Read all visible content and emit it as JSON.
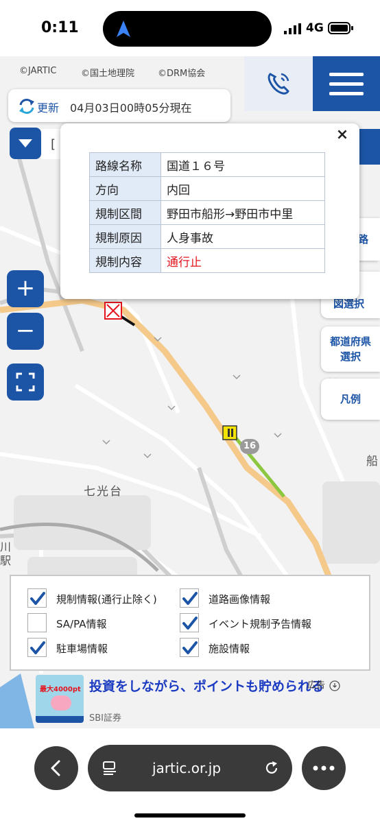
{
  "status_bar": {
    "time": "0:11",
    "network": "4G"
  },
  "map": {
    "credits": [
      "©JARTIC",
      "©国土地理院",
      "©DRM協会"
    ],
    "place_label": "七光台",
    "route_shield": "16",
    "edge_label_right": "船",
    "edge_label_left": "川駅"
  },
  "update": {
    "label": "更新",
    "timestamp": "04月03日00時05分現在"
  },
  "search": {
    "partial_text": "["
  },
  "zoom": {
    "in_label": "+",
    "out_label": "−"
  },
  "side_buttons": [
    {
      "label": "路"
    },
    {
      "label": "路\n図選択"
    },
    {
      "label": "都道府県\n選択"
    },
    {
      "label": "凡例"
    }
  ],
  "popup": {
    "close_label": "×",
    "rows": [
      {
        "key": "路線名称",
        "value": "国道１６号"
      },
      {
        "key": "方向",
        "value": "内回"
      },
      {
        "key": "規制区間",
        "value": "野田市船形→野田市中里"
      },
      {
        "key": "規制原因",
        "value": "人身事故"
      },
      {
        "key": "規制内容",
        "value": "通行止"
      }
    ]
  },
  "filters": [
    {
      "label": "規制情報(通行止除く)",
      "checked": true
    },
    {
      "label": "道路画像情報",
      "checked": true
    },
    {
      "label": "SA/PA情報",
      "checked": false
    },
    {
      "label": "イベント規制予告情報",
      "checked": true
    },
    {
      "label": "駐車場情報",
      "checked": true
    },
    {
      "label": "施設情報",
      "checked": true
    }
  ],
  "ad": {
    "label": "広告",
    "title": "投資をしながら、ポイントも貯められる",
    "sponsor": "SBI証券",
    "image_text": "最大4000pt"
  },
  "browser": {
    "url": "jartic.or.jp"
  },
  "colors": {
    "brand_blue": "#1d55a6",
    "closure_red": "#e5141e",
    "route_orange": "#f4c98a"
  }
}
